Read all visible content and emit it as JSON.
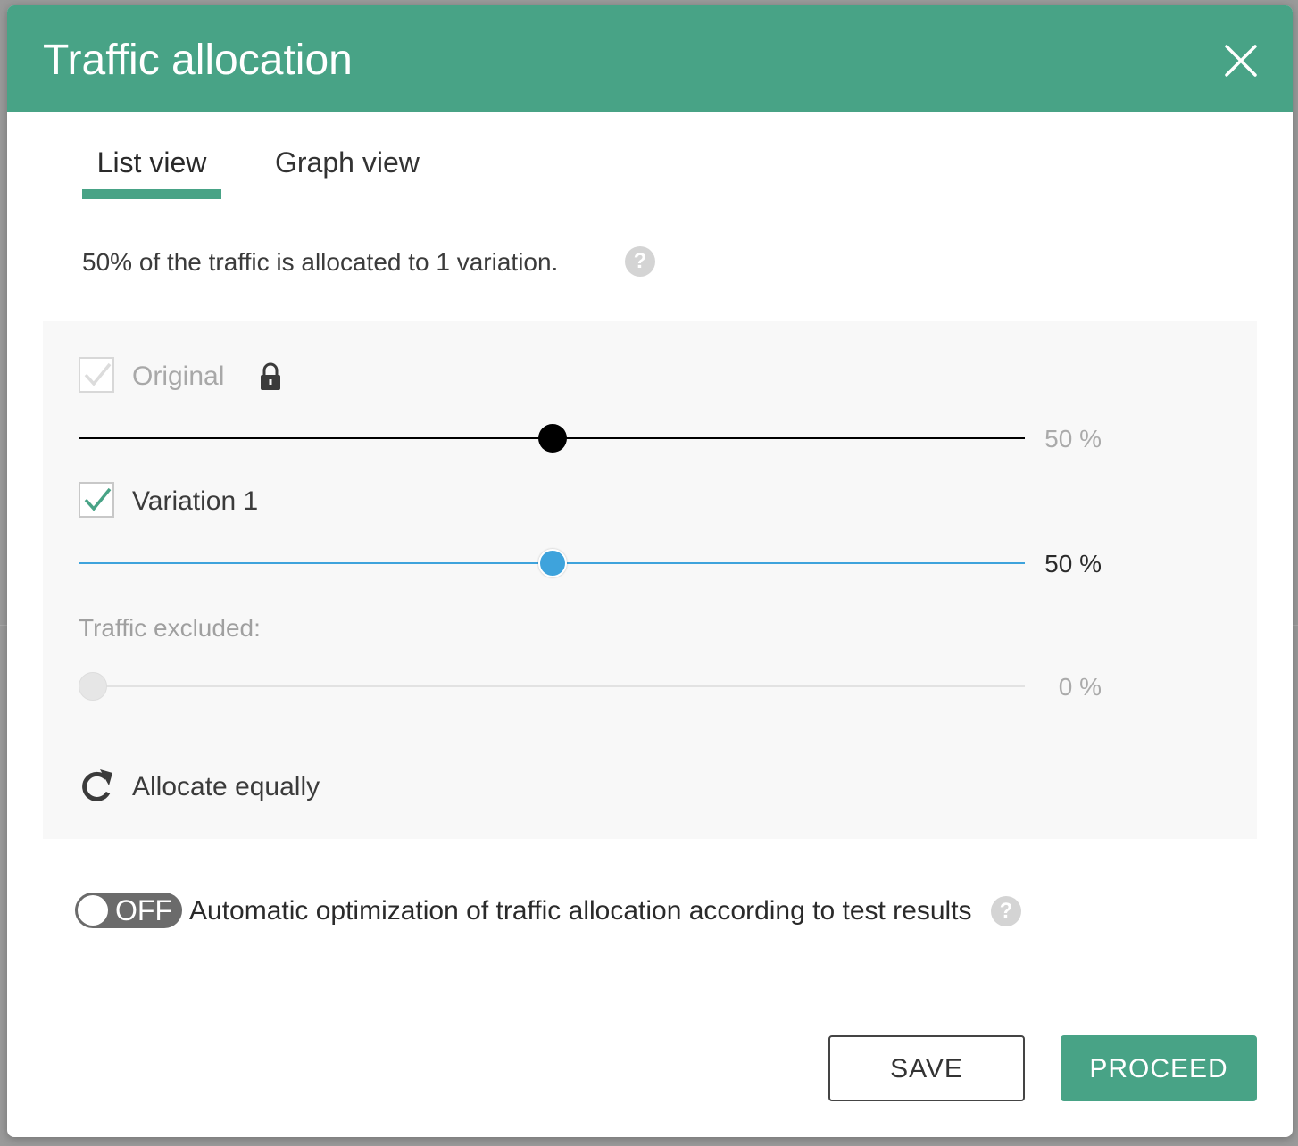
{
  "dialog": {
    "title": "Traffic allocation"
  },
  "tabs": [
    {
      "label": "List view",
      "active": true
    },
    {
      "label": "Graph view",
      "active": false
    }
  ],
  "summary": "50% of the traffic is allocated to 1 variation.",
  "help_glyph": "?",
  "allocation": {
    "original": {
      "label": "Original",
      "checked": true,
      "locked": true,
      "percent_label": "50 %",
      "value": 50
    },
    "variation_1": {
      "label": "Variation 1",
      "checked": true,
      "percent_label": "50 %",
      "value": 50
    },
    "excluded": {
      "label": "Traffic excluded:",
      "percent_label": "0 %",
      "value": 0
    },
    "allocate_equally_label": "Allocate equally"
  },
  "auto_optimization": {
    "toggle_state": "OFF",
    "label": "Automatic optimization of traffic allocation according to test results"
  },
  "footer": {
    "save_label": "SAVE",
    "proceed_label": "PROCEED"
  },
  "colors": {
    "brand": "#48a386",
    "slider_blue": "#3ea3dc",
    "slider_black": "#000000"
  },
  "icons": {
    "close": "close-icon",
    "help": "help-icon",
    "lock": "lock-icon",
    "check": "check-icon",
    "refresh": "refresh-icon"
  }
}
